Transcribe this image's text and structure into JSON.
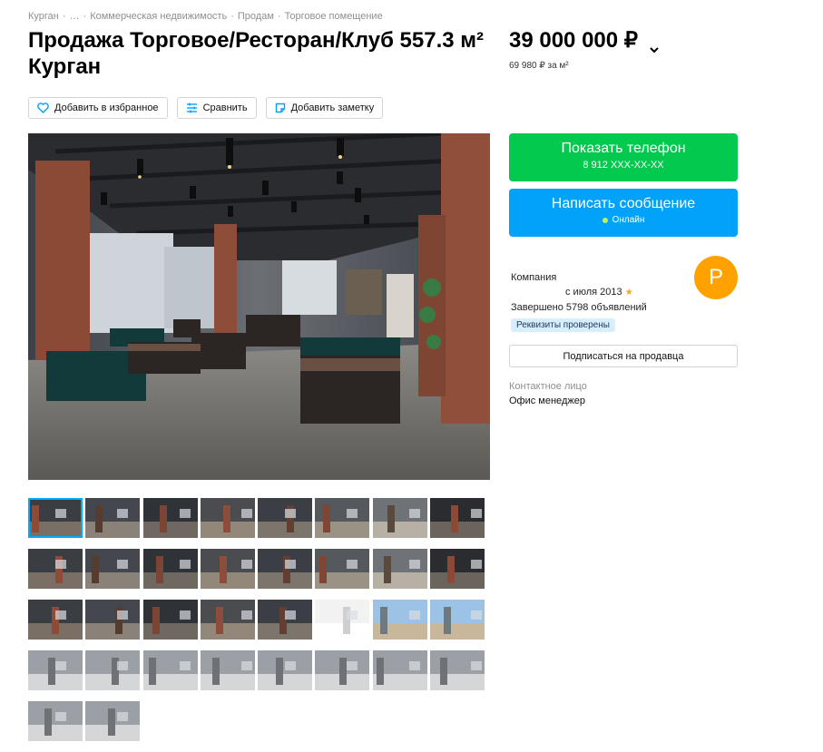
{
  "breadcrumb": {
    "items": [
      "Курган",
      "…",
      "Коммерческая недвижимость",
      "Продам",
      "Торговое помещение"
    ],
    "separator": "·"
  },
  "listing": {
    "title": "Продажа Торговое/Ресторан/Клуб 557.3 м² Курган",
    "price": "39 000 000 ₽",
    "price_per_m2": "69 980 ₽ за м²"
  },
  "actions": {
    "favorite": "Добавить в избранное",
    "compare": "Сравнить",
    "note": "Добавить заметку"
  },
  "contact": {
    "phone_button": "Показать телефон",
    "phone_masked": "8 912 XXX-XX-XX",
    "message_button": "Написать сообщение",
    "online_status": "Онлайн",
    "subscribe_button": "Подписаться на продавца",
    "contact_person_label": "Контактное лицо",
    "contact_person": "Офис менеджер"
  },
  "seller": {
    "type": "Компания",
    "since": "с июля 2013",
    "completed": "Завершено 5798 объявлений",
    "verified_badge": "Реквизиты проверены",
    "avatar_letter": "Р"
  },
  "colors": {
    "phone_green": "#04c94f",
    "message_blue": "#02a2fa",
    "avatar_orange": "#ffa200",
    "verified_bg": "#d7eefd",
    "active_thumb": "#00aaff"
  },
  "gallery": {
    "main_photo": "restaurant-interior",
    "thumbnail_count": 34,
    "active_index": 0
  }
}
